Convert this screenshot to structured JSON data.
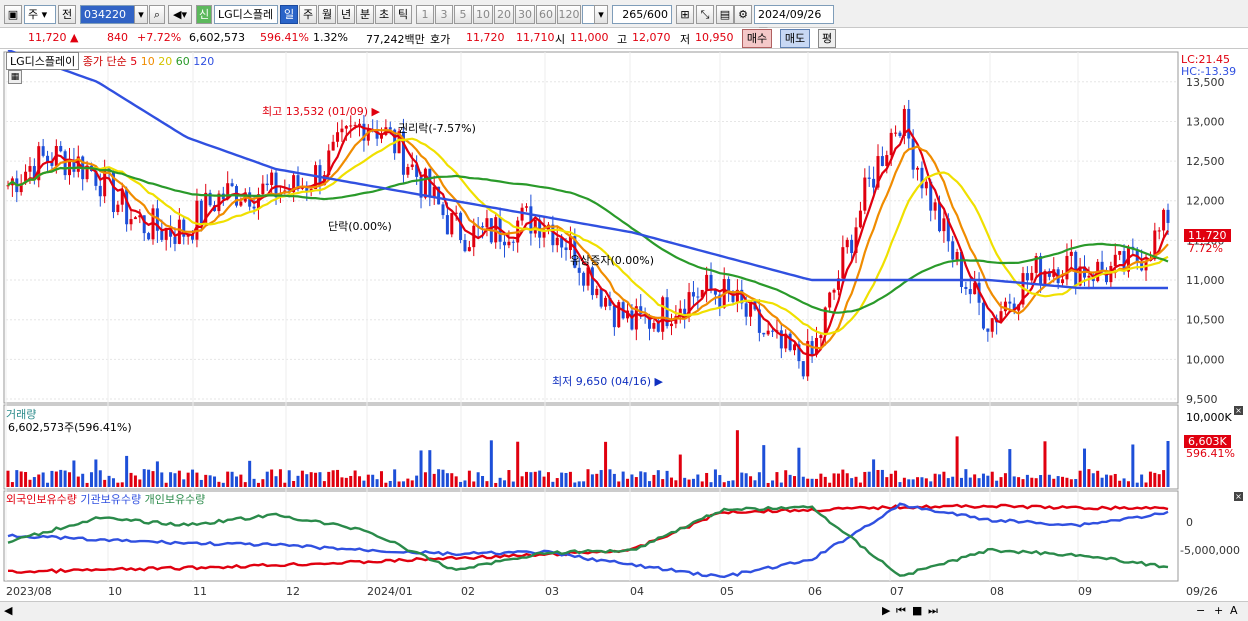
{
  "toolbar": {
    "type_value": "주",
    "prev_label": "전",
    "code": "034220",
    "new_badge": "신",
    "stock_name": "LG디스플레",
    "periods": [
      "일",
      "주",
      "월",
      "년",
      "분",
      "초",
      "틱"
    ],
    "period_selected": "일",
    "intervals": [
      "1",
      "3",
      "5",
      "10",
      "20",
      "30",
      "60",
      "120"
    ],
    "count": "265",
    "count_total": "/600",
    "date": "2024/09/26"
  },
  "quote": {
    "price": "11,720 ▲",
    "change": "840",
    "change_pct": "+7.72%",
    "volume": "6,602,573",
    "volume_pct": "596.41%",
    "turnover_pct": "1.32%",
    "amount": "77,242백만",
    "hoga_label": "호가",
    "ask": "11,720",
    "bid": "11,710",
    "open_label": "시",
    "open": "11,000",
    "high_label": "고",
    "high": "12,070",
    "low_label": "저",
    "low": "10,950",
    "buy_label": "매수",
    "sell_label": "매도",
    "eval_label": "평"
  },
  "legend": {
    "name": "LG디스플레이",
    "ma_title": "종가 단순",
    "ma_periods": [
      "5",
      "10",
      "20",
      "60",
      "120"
    ],
    "ma_colors": [
      "#e0000f",
      "#f08c00",
      "#f0e000",
      "#2a9a2a",
      "#3050e0"
    ]
  },
  "price_panel": {
    "lc": "LC:21.45",
    "hc": "HC:-13.39",
    "last_price": "11,720",
    "last_pct": "7.72%",
    "high_annotation": "최고 13,532 (01/09)",
    "low_annotation": "최저 9,650 (04/16)",
    "rights_annotation": "권리락(-7.57%)",
    "single_annotation": "단락(0.00%)",
    "cap_increase_annotation": "유상증자(0.00%)",
    "y_ticks": [
      "13,500",
      "13,000",
      "12,500",
      "12,000",
      "11,500",
      "11,000",
      "10,500",
      "10,000",
      "9,500"
    ]
  },
  "volume_panel": {
    "title": "거래량",
    "value": "6,602,573주(596.41%)",
    "y_tick": "10,000K",
    "tag": "6,603K",
    "tag_pct": "596.41%"
  },
  "holding_panel": {
    "series": [
      "외국인보유수량",
      "기관보유수량",
      "개인보유수량"
    ],
    "colors": [
      "#e0000f",
      "#3050e0",
      "#2a8a4a"
    ],
    "y_ticks": [
      "0",
      "-5,000,000"
    ]
  },
  "x_axis": [
    "2023/08",
    "10",
    "11",
    "12",
    "2024/01",
    "02",
    "03",
    "04",
    "05",
    "06",
    "07",
    "08",
    "09",
    "09/26"
  ],
  "chart_data": {
    "type": "candlestick",
    "title": "",
    "x": [
      "2023/08",
      "10",
      "11",
      "12",
      "2024/01",
      "02",
      "03",
      "04",
      "05",
      "06",
      "07",
      "08",
      "09",
      "09/26"
    ],
    "close_approx": [
      12200,
      12400,
      11500,
      12300,
      12800,
      11900,
      11500,
      10700,
      10600,
      10200,
      12900,
      10600,
      11100,
      11720
    ],
    "ma120_approx": [
      13900,
      13500,
      12800,
      12400,
      12200,
      12000,
      11800,
      11600,
      11300,
      11000,
      11000,
      11000,
      10900,
      10900
    ],
    "ylim": [
      9500,
      13800
    ],
    "annotations": [
      "최고 13,532 (01/09)",
      "최저 9,650 (04/16)"
    ]
  }
}
